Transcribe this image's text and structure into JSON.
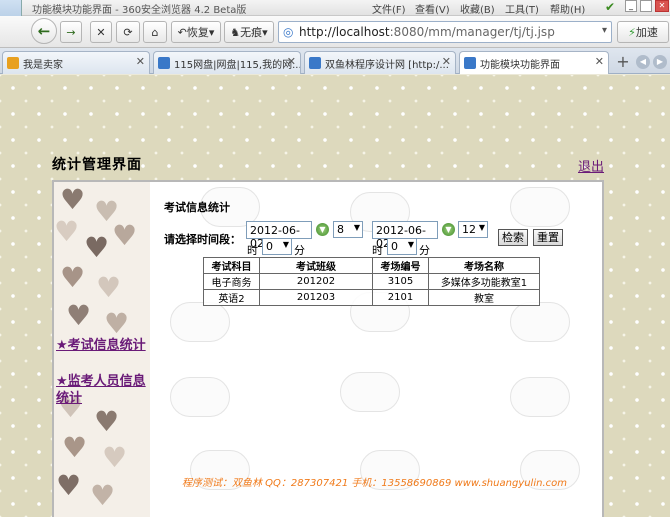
{
  "window": {
    "title": "功能模块功能界面 - 360安全浏览器 4.2 Beta版"
  },
  "menu": [
    "文件(F)",
    "查看(V)",
    "收藏(B)",
    "工具(T)",
    "帮助(H)"
  ],
  "toolbar": {
    "restore_label": "恢复",
    "no_image_label": "无痕",
    "accelerate_label": "加速"
  },
  "address": {
    "host": "http://localhost",
    "path": ":8080/mm/manager/tj/tj.jsp"
  },
  "tabs": [
    {
      "label": "我是卖家",
      "color": "#e8a020"
    },
    {
      "label": "115网盘|网盘|115,我的网...",
      "color": "#3a78c8"
    },
    {
      "label": "双鱼林程序设计网 [http:/...",
      "color": "#3a78c8"
    },
    {
      "label": "功能模块功能界面",
      "color": "#3a78c8"
    }
  ],
  "page": {
    "title": "统计管理界面",
    "logout": "退出",
    "sidebar": {
      "link1": "★考试信息统计",
      "link2": "★监考人员信息统计"
    },
    "section_title": "考试信息统计",
    "range_label": "请选择时间段：",
    "start": {
      "date": "2012-06-02",
      "hour": "8",
      "minute": "0"
    },
    "end": {
      "date": "2012-06-02",
      "hour": "12",
      "minute": "0"
    },
    "hour_label": "时",
    "minute_label": "分",
    "search_button": "检索",
    "reset_button": "重置",
    "table": {
      "headers": [
        "考试科目",
        "考试班级",
        "考场编号",
        "考场名称"
      ],
      "rows": [
        [
          "电子商务",
          "201202",
          "3105",
          "多媒体多功能教室1"
        ],
        [
          "英语2",
          "201203",
          "2101",
          "教室"
        ]
      ]
    },
    "footer": "程序测试：双鱼林   QQ：287307421   手机：13558690869   www.shuangyulin.com"
  },
  "colors": {
    "link": "#6a1b78",
    "footer": "#f07a1a",
    "background": "#ddd9bd"
  }
}
